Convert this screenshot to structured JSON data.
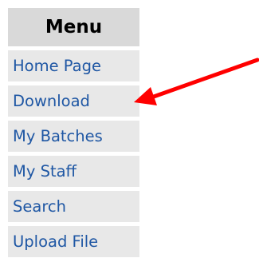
{
  "menu": {
    "title": "Menu",
    "items": [
      {
        "label": "Home Page"
      },
      {
        "label": "Download"
      },
      {
        "label": "My Batches"
      },
      {
        "label": "My Staff"
      },
      {
        "label": "Search"
      },
      {
        "label": "Upload File"
      }
    ]
  },
  "annotation": {
    "arrow_color": "#ff0000",
    "points_to": "Download"
  },
  "colors": {
    "header_bg": "#d9d9d9",
    "item_bg": "#e8e8e8",
    "link": "#1f57a4"
  }
}
